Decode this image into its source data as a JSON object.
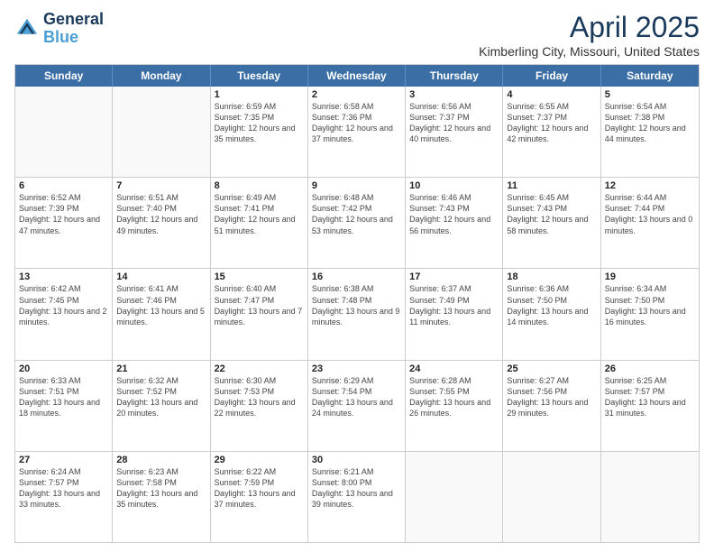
{
  "logo": {
    "line1": "General",
    "line2": "Blue"
  },
  "title": "April 2025",
  "subtitle": "Kimberling City, Missouri, United States",
  "days": [
    "Sunday",
    "Monday",
    "Tuesday",
    "Wednesday",
    "Thursday",
    "Friday",
    "Saturday"
  ],
  "weeks": [
    [
      {
        "day": "",
        "info": ""
      },
      {
        "day": "",
        "info": ""
      },
      {
        "day": "1",
        "info": "Sunrise: 6:59 AM\nSunset: 7:35 PM\nDaylight: 12 hours and 35 minutes."
      },
      {
        "day": "2",
        "info": "Sunrise: 6:58 AM\nSunset: 7:36 PM\nDaylight: 12 hours and 37 minutes."
      },
      {
        "day": "3",
        "info": "Sunrise: 6:56 AM\nSunset: 7:37 PM\nDaylight: 12 hours and 40 minutes."
      },
      {
        "day": "4",
        "info": "Sunrise: 6:55 AM\nSunset: 7:37 PM\nDaylight: 12 hours and 42 minutes."
      },
      {
        "day": "5",
        "info": "Sunrise: 6:54 AM\nSunset: 7:38 PM\nDaylight: 12 hours and 44 minutes."
      }
    ],
    [
      {
        "day": "6",
        "info": "Sunrise: 6:52 AM\nSunset: 7:39 PM\nDaylight: 12 hours and 47 minutes."
      },
      {
        "day": "7",
        "info": "Sunrise: 6:51 AM\nSunset: 7:40 PM\nDaylight: 12 hours and 49 minutes."
      },
      {
        "day": "8",
        "info": "Sunrise: 6:49 AM\nSunset: 7:41 PM\nDaylight: 12 hours and 51 minutes."
      },
      {
        "day": "9",
        "info": "Sunrise: 6:48 AM\nSunset: 7:42 PM\nDaylight: 12 hours and 53 minutes."
      },
      {
        "day": "10",
        "info": "Sunrise: 6:46 AM\nSunset: 7:43 PM\nDaylight: 12 hours and 56 minutes."
      },
      {
        "day": "11",
        "info": "Sunrise: 6:45 AM\nSunset: 7:43 PM\nDaylight: 12 hours and 58 minutes."
      },
      {
        "day": "12",
        "info": "Sunrise: 6:44 AM\nSunset: 7:44 PM\nDaylight: 13 hours and 0 minutes."
      }
    ],
    [
      {
        "day": "13",
        "info": "Sunrise: 6:42 AM\nSunset: 7:45 PM\nDaylight: 13 hours and 2 minutes."
      },
      {
        "day": "14",
        "info": "Sunrise: 6:41 AM\nSunset: 7:46 PM\nDaylight: 13 hours and 5 minutes."
      },
      {
        "day": "15",
        "info": "Sunrise: 6:40 AM\nSunset: 7:47 PM\nDaylight: 13 hours and 7 minutes."
      },
      {
        "day": "16",
        "info": "Sunrise: 6:38 AM\nSunset: 7:48 PM\nDaylight: 13 hours and 9 minutes."
      },
      {
        "day": "17",
        "info": "Sunrise: 6:37 AM\nSunset: 7:49 PM\nDaylight: 13 hours and 11 minutes."
      },
      {
        "day": "18",
        "info": "Sunrise: 6:36 AM\nSunset: 7:50 PM\nDaylight: 13 hours and 14 minutes."
      },
      {
        "day": "19",
        "info": "Sunrise: 6:34 AM\nSunset: 7:50 PM\nDaylight: 13 hours and 16 minutes."
      }
    ],
    [
      {
        "day": "20",
        "info": "Sunrise: 6:33 AM\nSunset: 7:51 PM\nDaylight: 13 hours and 18 minutes."
      },
      {
        "day": "21",
        "info": "Sunrise: 6:32 AM\nSunset: 7:52 PM\nDaylight: 13 hours and 20 minutes."
      },
      {
        "day": "22",
        "info": "Sunrise: 6:30 AM\nSunset: 7:53 PM\nDaylight: 13 hours and 22 minutes."
      },
      {
        "day": "23",
        "info": "Sunrise: 6:29 AM\nSunset: 7:54 PM\nDaylight: 13 hours and 24 minutes."
      },
      {
        "day": "24",
        "info": "Sunrise: 6:28 AM\nSunset: 7:55 PM\nDaylight: 13 hours and 26 minutes."
      },
      {
        "day": "25",
        "info": "Sunrise: 6:27 AM\nSunset: 7:56 PM\nDaylight: 13 hours and 29 minutes."
      },
      {
        "day": "26",
        "info": "Sunrise: 6:25 AM\nSunset: 7:57 PM\nDaylight: 13 hours and 31 minutes."
      }
    ],
    [
      {
        "day": "27",
        "info": "Sunrise: 6:24 AM\nSunset: 7:57 PM\nDaylight: 13 hours and 33 minutes."
      },
      {
        "day": "28",
        "info": "Sunrise: 6:23 AM\nSunset: 7:58 PM\nDaylight: 13 hours and 35 minutes."
      },
      {
        "day": "29",
        "info": "Sunrise: 6:22 AM\nSunset: 7:59 PM\nDaylight: 13 hours and 37 minutes."
      },
      {
        "day": "30",
        "info": "Sunrise: 6:21 AM\nSunset: 8:00 PM\nDaylight: 13 hours and 39 minutes."
      },
      {
        "day": "",
        "info": ""
      },
      {
        "day": "",
        "info": ""
      },
      {
        "day": "",
        "info": ""
      }
    ]
  ]
}
